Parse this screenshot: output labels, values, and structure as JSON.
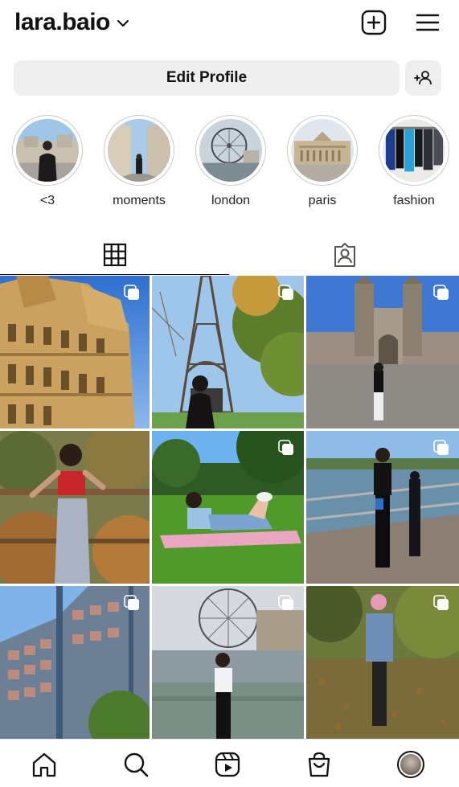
{
  "header": {
    "username": "lara.baio",
    "icons": [
      "chevron-down-icon",
      "new-post-icon",
      "menu-icon"
    ]
  },
  "profile_actions": {
    "edit_label": "Edit Profile",
    "discover_icon": "add-person-icon"
  },
  "highlights": [
    {
      "label": "<3"
    },
    {
      "label": "moments"
    },
    {
      "label": "london"
    },
    {
      "label": "paris"
    },
    {
      "label": "fashion"
    }
  ],
  "tabs": [
    {
      "name": "posts",
      "icon": "grid-icon",
      "active": true
    },
    {
      "name": "tagged",
      "icon": "tagged-icon",
      "active": false
    }
  ],
  "posts": [
    {
      "subject": "ornate building",
      "multiple": true
    },
    {
      "subject": "eiffel tower",
      "multiple": true
    },
    {
      "subject": "natural history museum",
      "multiple": true
    },
    {
      "subject": "autumn forest railing",
      "multiple": false
    },
    {
      "subject": "lying on grass",
      "multiple": true
    },
    {
      "subject": "seaside railing",
      "multiple": true
    },
    {
      "subject": "modern building",
      "multiple": true
    },
    {
      "subject": "london eye bridge",
      "multiple": true
    },
    {
      "subject": "autumn park",
      "multiple": true
    }
  ],
  "bottom_nav": [
    "home-icon",
    "search-icon",
    "reels-icon",
    "shop-icon",
    "profile-avatar"
  ]
}
